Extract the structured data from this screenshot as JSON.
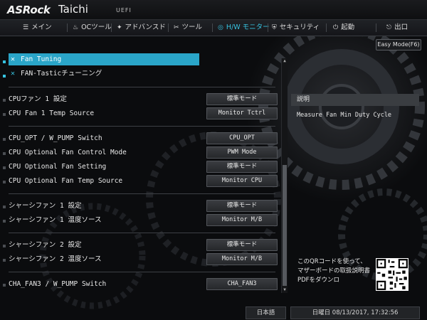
{
  "header": {
    "brand": "ASRock",
    "model": "Taichi",
    "uefi": "UEFI"
  },
  "nav": {
    "tabs": [
      {
        "label": "メイン",
        "icon": "list-icon",
        "ico": "☰"
      },
      {
        "label": "OCツール",
        "icon": "flame-icon",
        "ico": "♨"
      },
      {
        "label": "アドバンスド",
        "icon": "star-icon",
        "ico": "✦"
      },
      {
        "label": "ツール",
        "icon": "wrench-icon",
        "ico": "✂"
      },
      {
        "label": "H/W モニター",
        "icon": "monitor-icon",
        "ico": "◎"
      },
      {
        "label": "セキュリティ",
        "icon": "shield-icon",
        "ico": "⛨"
      },
      {
        "label": "起動",
        "icon": "power-icon",
        "ico": "⏻"
      },
      {
        "label": "出口",
        "icon": "exit-icon",
        "ico": "⎋"
      }
    ],
    "active": "H/W モニター"
  },
  "easy_mode": "Easy Mode(F6)",
  "menu": {
    "fan_tuning": "Fan Tuning",
    "fan_tastic": "FAN-Tasticチューニング",
    "items": [
      {
        "label": "CPUファン 1 設定",
        "value": "標準モード"
      },
      {
        "label": "CPU Fan 1 Temp Source",
        "value": "Monitor Tctrl"
      },
      {
        "label": "CPU_OPT / W_PUMP Switch",
        "value": "CPU_OPT"
      },
      {
        "label": "CPU Optional Fan Control Mode",
        "value": "PWM Mode"
      },
      {
        "label": "CPU Optional Fan Setting",
        "value": "標準モード"
      },
      {
        "label": "CPU Optional Fan Temp Source",
        "value": "Monitor CPU"
      },
      {
        "label": "シャーシファン 1 設定",
        "value": "標準モード"
      },
      {
        "label": "シャーシファン 1 温度ソース",
        "value": "Monitor M/B"
      },
      {
        "label": "シャーシファン 2 設定",
        "value": "標準モード"
      },
      {
        "label": "シャーシファン 2 温度ソース",
        "value": "Monitor M/B"
      },
      {
        "label": "CHA_FAN3 / W_PUMP Switch",
        "value": "CHA_FAN3"
      }
    ]
  },
  "description": {
    "title": "説明",
    "text": "Measure Fan Min Duty Cycle"
  },
  "qr": {
    "text": "このQRコードを使って、マザーボードの取扱説明書PDFをダウンロ"
  },
  "footer": {
    "language": "日本語",
    "datetime": "日曜日 08/13/2017, 17:32:56"
  }
}
